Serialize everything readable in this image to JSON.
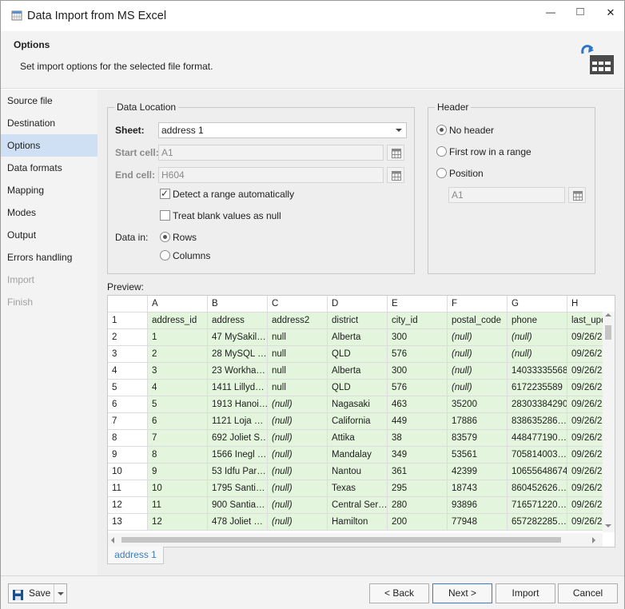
{
  "window": {
    "title": "Data Import from MS Excel",
    "minimize_glyph": "—",
    "maximize_glyph": "□",
    "close_glyph": "✕"
  },
  "header": {
    "title": "Options",
    "subtitle": "Set import options for the selected file format."
  },
  "sidebar": {
    "items": [
      {
        "label": "Source file",
        "state": "normal"
      },
      {
        "label": "Destination",
        "state": "normal"
      },
      {
        "label": "Options",
        "state": "active"
      },
      {
        "label": "Data formats",
        "state": "normal"
      },
      {
        "label": "Mapping",
        "state": "normal"
      },
      {
        "label": "Modes",
        "state": "normal"
      },
      {
        "label": "Output",
        "state": "normal"
      },
      {
        "label": "Errors handling",
        "state": "normal"
      },
      {
        "label": "Import",
        "state": "disabled"
      },
      {
        "label": "Finish",
        "state": "disabled"
      }
    ]
  },
  "data_location": {
    "group_title": "Data Location",
    "sheet_label": "Sheet:",
    "sheet_value": "address 1",
    "start_cell_label": "Start cell:",
    "start_cell_value": "A1",
    "end_cell_label": "End cell:",
    "end_cell_value": "H604",
    "detect_range_label": "Detect a range automatically",
    "detect_range_checked": true,
    "treat_blank_label": "Treat blank values as null",
    "treat_blank_checked": false,
    "data_in_label": "Data in:",
    "rows_label": "Rows",
    "columns_label": "Columns",
    "data_in_selected": "Rows"
  },
  "header_group": {
    "group_title": "Header",
    "no_header_label": "No header",
    "first_row_label": "First row in a range",
    "position_label": "Position",
    "selected": "No header",
    "position_value": "A1"
  },
  "preview": {
    "label": "Preview:",
    "column_letters": [
      "A",
      "B",
      "C",
      "D",
      "E",
      "F",
      "G",
      "H"
    ],
    "rows": [
      [
        "1",
        "address_id",
        "address",
        "address2",
        "district",
        "city_id",
        "postal_code",
        "phone",
        "last_upd"
      ],
      [
        "2",
        "1",
        "47 MySakil…",
        "null",
        "Alberta",
        "300",
        "(null)",
        "(null)",
        "09/26/2"
      ],
      [
        "3",
        "2",
        "28 MySQL …",
        "null",
        "QLD",
        "576",
        "(null)",
        "(null)",
        "09/26/2"
      ],
      [
        "4",
        "3",
        "23 Workha…",
        "null",
        "Alberta",
        "300",
        "(null)",
        "14033335568",
        "09/26/2"
      ],
      [
        "5",
        "4",
        "1411 Lillyd…",
        "null",
        "QLD",
        "576",
        "(null)",
        "6172235589",
        "09/26/2"
      ],
      [
        "6",
        "5",
        "1913 Hanoi…",
        "(null)",
        "Nagasaki",
        "463",
        "35200",
        "28303384290",
        "09/26/2"
      ],
      [
        "7",
        "6",
        "1121 Loja …",
        "(null)",
        "California",
        "449",
        "17886",
        "838635286…",
        "09/26/2"
      ],
      [
        "8",
        "7",
        "692 Joliet S…",
        "(null)",
        "Attika",
        "38",
        "83579",
        "448477190…",
        "09/26/2"
      ],
      [
        "9",
        "8",
        "1566 Inegl …",
        "(null)",
        "Mandalay",
        "349",
        "53561",
        "705814003…",
        "09/26/2"
      ],
      [
        "10",
        "9",
        "53 Idfu Par…",
        "(null)",
        "Nantou",
        "361",
        "42399",
        "10655648674",
        "09/26/2"
      ],
      [
        "11",
        "10",
        "1795 Santi…",
        "(null)",
        "Texas",
        "295",
        "18743",
        "860452626…",
        "09/26/2"
      ],
      [
        "12",
        "11",
        "900 Santia…",
        "(null)",
        "Central Ser…",
        "280",
        "93896",
        "716571220…",
        "09/26/2"
      ],
      [
        "13",
        "12",
        "478 Joliet …",
        "(null)",
        "Hamilton",
        "200",
        "77948",
        "657282285…",
        "09/26/2"
      ]
    ],
    "sheet_tab": "address 1"
  },
  "footer": {
    "save_label": "Save",
    "back_label": "< Back",
    "next_label": "Next >",
    "import_label": "Import",
    "cancel_label": "Cancel"
  },
  "colors": {
    "accent": "#3a7bc8",
    "data_cell_bg": "#e3f5dc",
    "active_nav_bg": "#cfe0f4"
  }
}
